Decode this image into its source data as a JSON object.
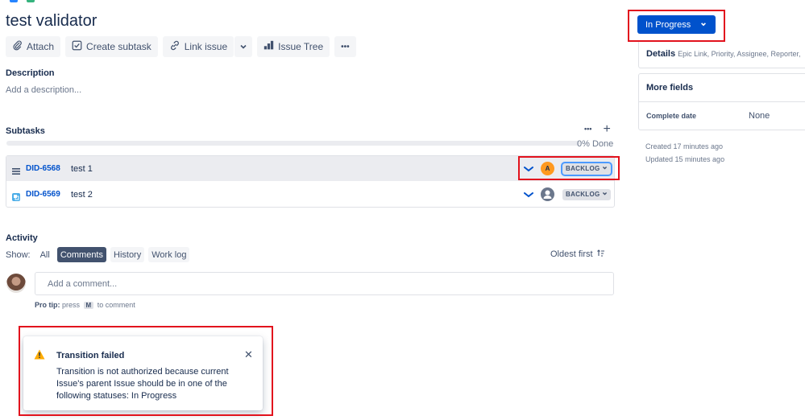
{
  "issue": {
    "title": "test validator"
  },
  "toolbar": {
    "attach": "Attach",
    "create_subtask": "Create subtask",
    "link_issue": "Link issue",
    "issue_tree": "Issue Tree",
    "more": "•••"
  },
  "description": {
    "heading": "Description",
    "placeholder": "Add a description..."
  },
  "subtasks": {
    "heading": "Subtasks",
    "more": "•••",
    "add": "+",
    "progress_fraction": 0,
    "progress_label": "0% Done",
    "rows": [
      {
        "key": "DID-6568",
        "summary": "test 1",
        "assignee_initial": "A",
        "status": "BACKLOG",
        "type_icon": "subtask-lines-icon"
      },
      {
        "key": "DID-6569",
        "summary": "test 2",
        "assignee_initial": "",
        "status": "BACKLOG",
        "type_icon": "subtask-square-icon"
      }
    ]
  },
  "activity": {
    "heading": "Activity",
    "show_label": "Show:",
    "filters": [
      "All",
      "Comments",
      "History",
      "Work log"
    ],
    "active_filter": "Comments",
    "sort": "Oldest first",
    "comment_placeholder": "Add a comment...",
    "protip_label": "Pro tip:",
    "protip_press": "press",
    "protip_key": "M",
    "protip_suffix": "to comment"
  },
  "flag": {
    "title": "Transition failed",
    "body": "Transition is not authorized because current Issue's parent Issue should be in one of the following statuses: In Progress",
    "close": "✕"
  },
  "sidebar": {
    "status": "In Progress",
    "details_title": "Details",
    "details_sub": "Epic Link, Priority, Assignee, Reporter,",
    "more_fields": "More fields",
    "complete_date_label": "Complete date",
    "complete_date_value": "None",
    "created": "Created 17 minutes ago",
    "updated": "Updated 15 minutes ago"
  },
  "colors": {
    "primary": "#0052cc",
    "highlight_box": "#e2121d",
    "warning": "#ffab00",
    "assignee_avatar": "#ff991f"
  }
}
